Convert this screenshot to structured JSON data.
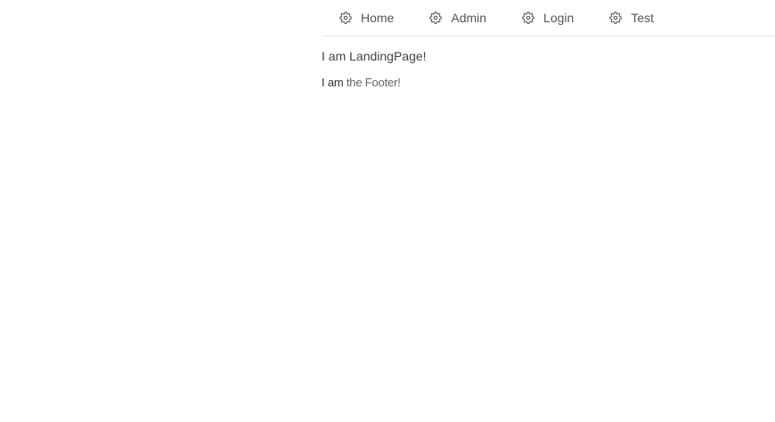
{
  "nav": {
    "items": [
      {
        "label": "Home",
        "icon": "gear-icon"
      },
      {
        "label": "Admin",
        "icon": "gear-icon"
      },
      {
        "label": "Login",
        "icon": "gear-icon"
      },
      {
        "label": "Test",
        "icon": "gear-icon"
      }
    ]
  },
  "main": {
    "landing_text": "I am LandingPage!"
  },
  "footer": {
    "text_prefix": "I am",
    "text_suffix": " the Footer!"
  },
  "colors": {
    "text": "#444444",
    "divider": "#e8e8e8",
    "background": "#ffffff"
  }
}
